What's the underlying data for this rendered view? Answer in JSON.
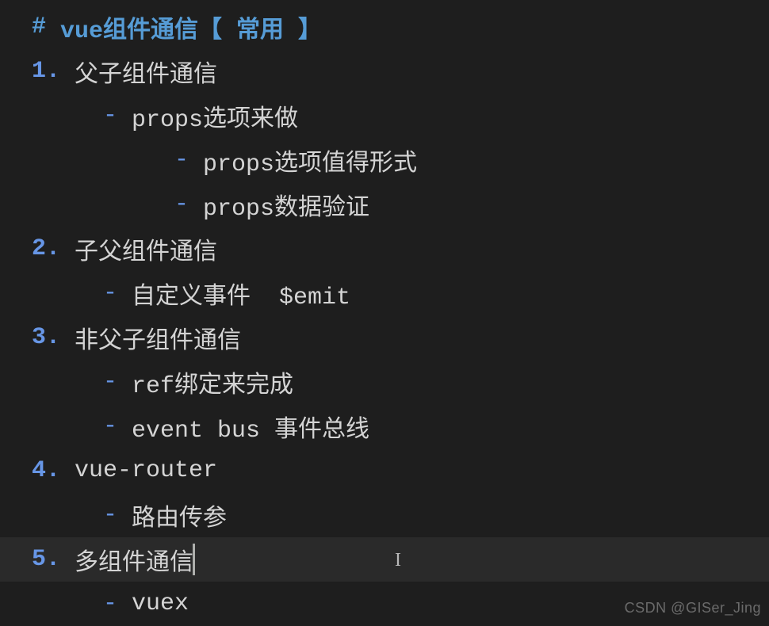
{
  "heading": {
    "hash": "#",
    "text": "vue组件通信【 常用 】"
  },
  "items": [
    {
      "n": "1",
      "label": "父子组件通信",
      "children": [
        {
          "label": "props选项来做",
          "children": [
            {
              "label": "props选项值得形式"
            },
            {
              "label": "props数据验证"
            }
          ]
        }
      ]
    },
    {
      "n": "2",
      "label": "子父组件通信",
      "children": [
        {
          "label": "自定义事件  $emit"
        }
      ]
    },
    {
      "n": "3",
      "label": "非父子组件通信",
      "children": [
        {
          "label": "ref绑定来完成"
        },
        {
          "label": "event bus 事件总线"
        }
      ]
    },
    {
      "n": "4",
      "label": "vue-router",
      "children": [
        {
          "label": "路由传参"
        }
      ]
    },
    {
      "n": "5",
      "label": "多组件通信",
      "active": true,
      "children": [
        {
          "label": "vuex"
        }
      ]
    }
  ],
  "watermark": "CSDN @GISer_Jing"
}
